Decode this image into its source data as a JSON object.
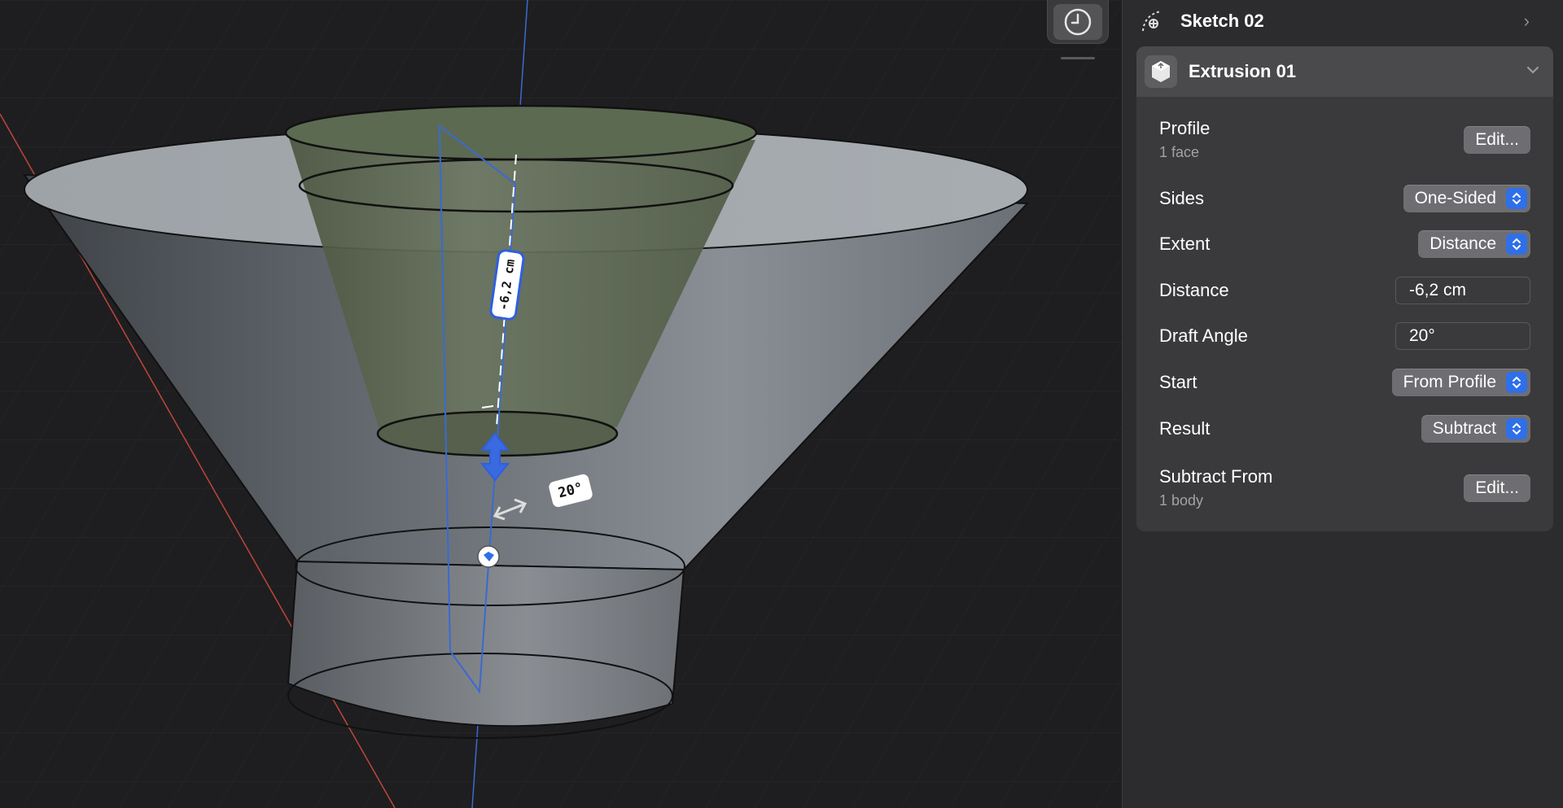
{
  "viewport": {
    "dimension_label": "-6,2 cm",
    "angle_label": "20°"
  },
  "tree": {
    "sketch": {
      "label": "Sketch 02"
    },
    "extrusion": {
      "label": "Extrusion 01"
    }
  },
  "properties": {
    "profile": {
      "label": "Profile",
      "sub": "1 face",
      "button": "Edit..."
    },
    "sides": {
      "label": "Sides",
      "value": "One-Sided"
    },
    "extent": {
      "label": "Extent",
      "value": "Distance"
    },
    "distance": {
      "label": "Distance",
      "value": "-6,2 cm"
    },
    "draft_angle": {
      "label": "Draft Angle",
      "value": "20°"
    },
    "start": {
      "label": "Start",
      "value": "From Profile"
    },
    "result": {
      "label": "Result",
      "value": "Subtract"
    },
    "subtract_from": {
      "label": "Subtract From",
      "sub": "1 body",
      "button": "Edit..."
    }
  },
  "colors": {
    "accent": "#2f6fe8",
    "panel_bg": "#2c2c2e",
    "card_bg": "#3a3a3c",
    "viewport_bg": "#1e1e20"
  }
}
